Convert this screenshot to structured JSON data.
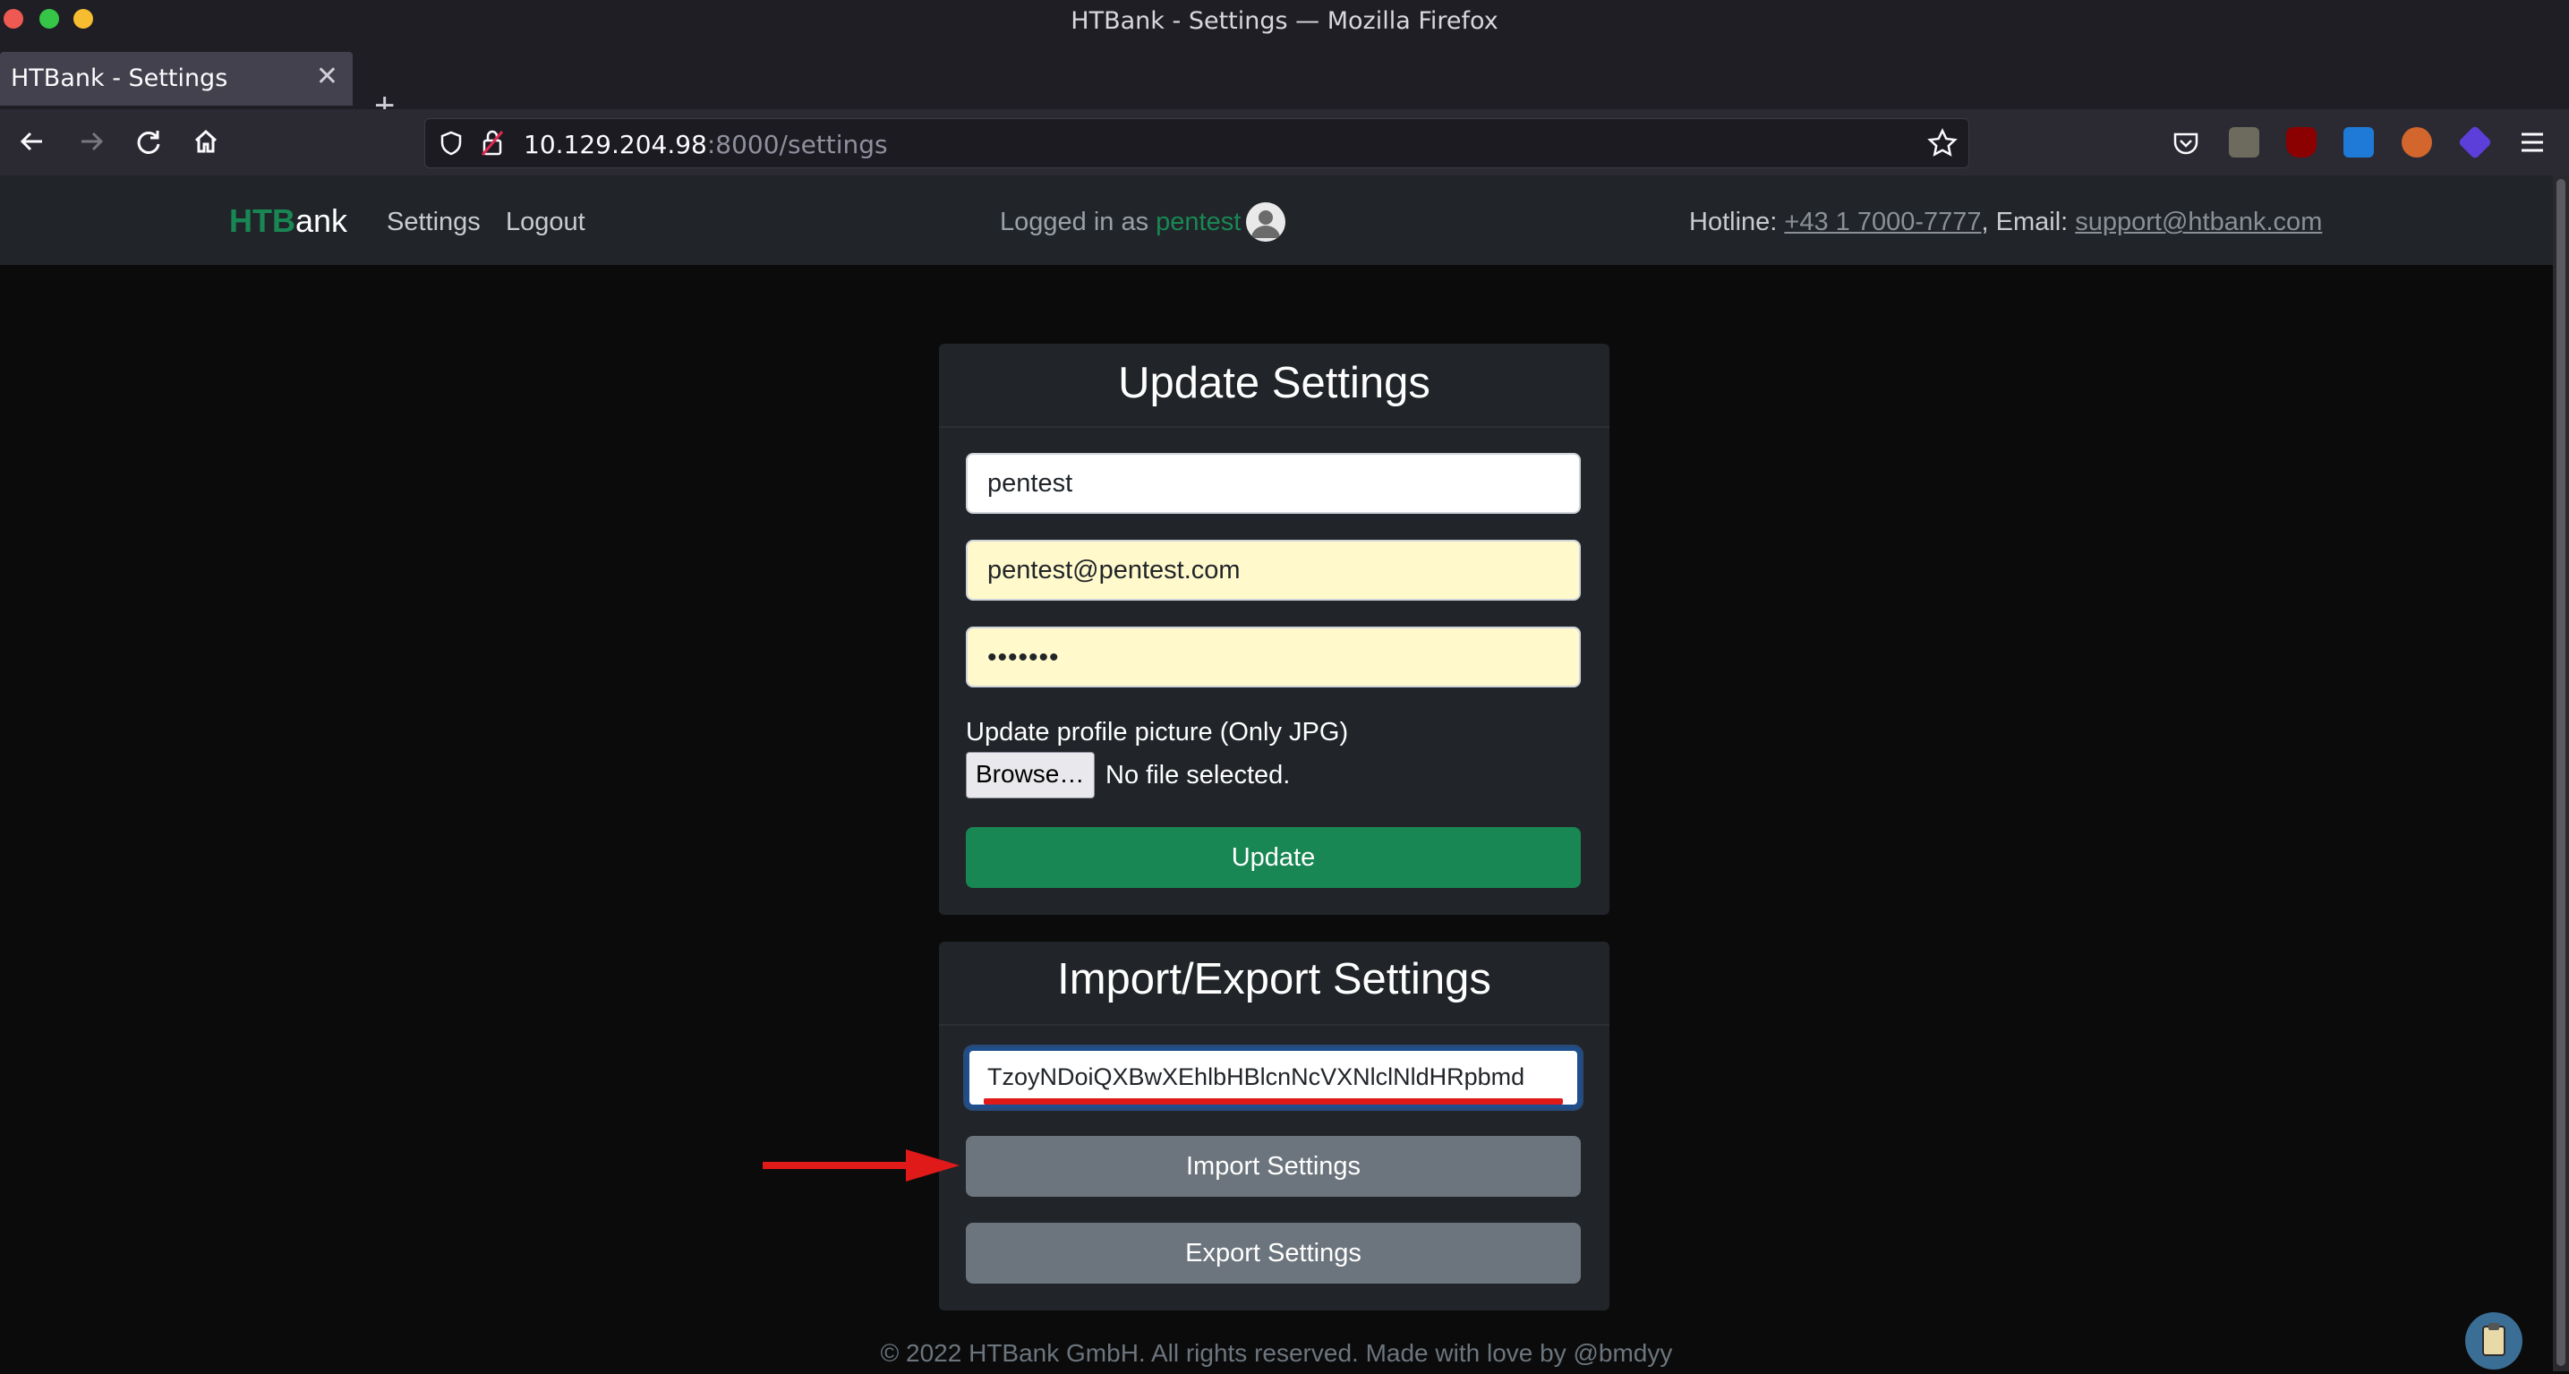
{
  "window": {
    "title": "HTBank - Settings — Mozilla Firefox"
  },
  "tab": {
    "title": "HTBank - Settings",
    "close": "✕",
    "new_tab": "+"
  },
  "url": {
    "host": "10.129.204.98",
    "rest": ":8000/settings"
  },
  "site": {
    "brand_green": "HTB",
    "brand_white": "ank",
    "nav_settings": "Settings",
    "nav_logout": "Logout",
    "logged_prefix": "Logged in as",
    "username": "pentest",
    "hotline_label": "Hotline:",
    "hotline": "+43 1 7000-7777",
    "email_label": ", Email:",
    "email": "support@htbank.com"
  },
  "update": {
    "title": "Update Settings",
    "username_value": "pentest",
    "email_value": "pentest@pentest.com",
    "password_value": "•••••••",
    "picture_label": "Update profile picture (Only JPG)",
    "browse_label": "Browse…",
    "no_file": "No file selected.",
    "button": "Update"
  },
  "import_export": {
    "title": "Import/Export Settings",
    "serialized_value": "TzoyNDoiQXBwXEhlbHBlcnNcVXNlclNldHRpbmd",
    "import_button": "Import Settings",
    "export_button": "Export Settings"
  },
  "footer": "© 2022 HTBank GmbH. All rights reserved. Made with love by @bmdyy",
  "colors": {
    "accent_green": "#198754",
    "annotation_red": "#e01919"
  }
}
